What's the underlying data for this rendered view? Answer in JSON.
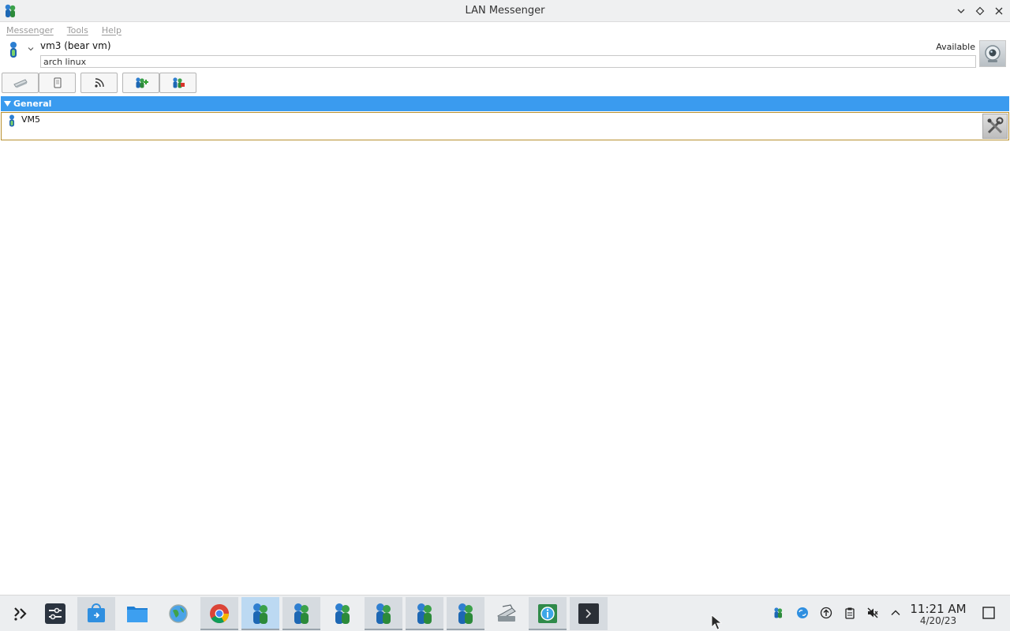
{
  "window": {
    "title": "LAN Messenger"
  },
  "menubar": {
    "items": [
      {
        "label": "Messenger"
      },
      {
        "label": "Tools"
      },
      {
        "label": "Help"
      }
    ]
  },
  "profile": {
    "username": "vm3 (bear vm)",
    "note": "arch linux",
    "status": "Available"
  },
  "toolbar": {
    "buttons": [
      {
        "icon": "broadcast-message-icon"
      },
      {
        "icon": "file-transfer-icon"
      },
      {
        "icon": "rss-icon"
      },
      {
        "icon": "add-contact-icon"
      },
      {
        "icon": "manage-group-icon"
      }
    ]
  },
  "contacts": {
    "groups": [
      {
        "name": "General",
        "members": [
          {
            "name": "VM5"
          }
        ]
      }
    ]
  },
  "taskbar": {
    "items": [
      {
        "icon": "app-launcher-icon"
      },
      {
        "icon": "settings-icon"
      },
      {
        "icon": "software-store-icon"
      },
      {
        "icon": "file-manager-icon"
      },
      {
        "icon": "browser-globe-icon"
      },
      {
        "icon": "chrome-icon"
      },
      {
        "icon": "lan-messenger-icon"
      },
      {
        "icon": "lan-messenger-icon"
      },
      {
        "icon": "lan-messenger-icon"
      },
      {
        "icon": "lan-messenger-icon"
      },
      {
        "icon": "lan-messenger-icon"
      },
      {
        "icon": "lan-messenger-icon"
      },
      {
        "icon": "scanner-icon"
      },
      {
        "icon": "system-info-icon"
      },
      {
        "icon": "terminal-icon"
      }
    ],
    "clock": {
      "time": "11:21 AM",
      "date": "4/20/23"
    }
  },
  "colors": {
    "group_header": "#3a9bef",
    "row_border": "#b8902f",
    "taskbar_bg": "#eceef0",
    "active_task": "#bcd9f2"
  }
}
